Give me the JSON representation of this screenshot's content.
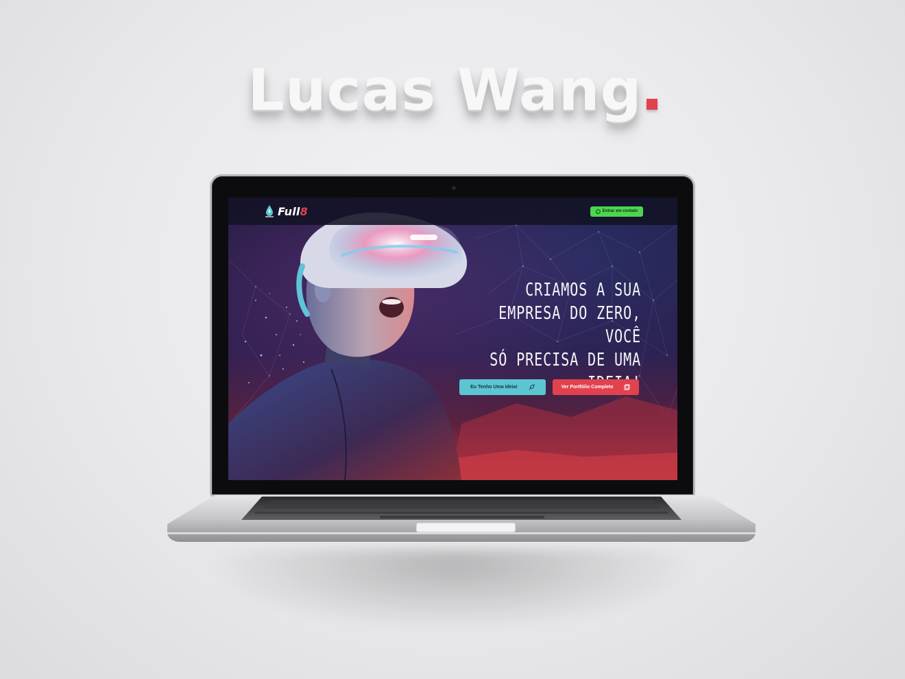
{
  "page": {
    "heading": "Lucas Wang",
    "accent_color": "#e1424e"
  },
  "site": {
    "brand": {
      "name_prefix": "Full",
      "name_suffix": "8",
      "icon": "drop-rocket-icon"
    },
    "nav": {
      "contact_label": "Entrar em contato",
      "contact_icon": "whatsapp-icon",
      "contact_color": "#4cd54f"
    },
    "hero": {
      "headline_lines": [
        "CRIAMOS A SUA",
        "EMPRESA DO ZERO, VOCÊ",
        "SÓ PRECISA DE UMA",
        "IDEIA!"
      ],
      "primary_cta": {
        "label": "Eu Tenho Uma Ideia!",
        "icon": "rocket-icon",
        "color": "#5bc6d2"
      },
      "secondary_cta": {
        "label": "Ver Portfólio Completo",
        "icon": "portfolio-icon",
        "color": "#e1424e"
      }
    }
  }
}
